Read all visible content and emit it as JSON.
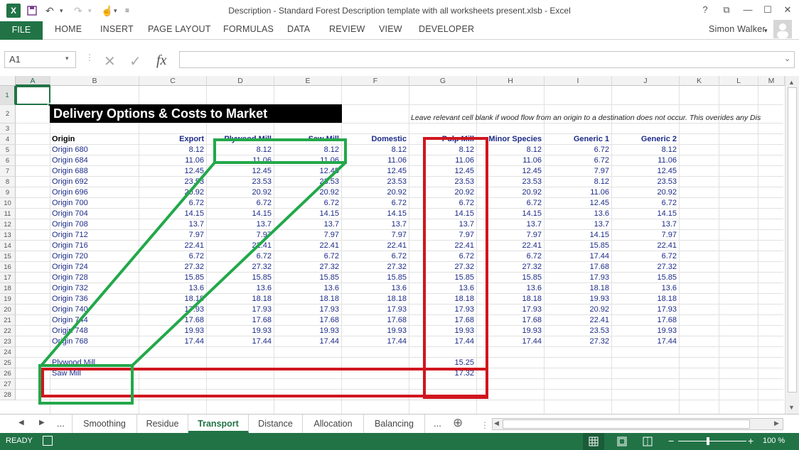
{
  "titlebar": {
    "app_icon": "X",
    "title": "Description - Standard Forest Description template with all worksheets present.xlsb - Excel",
    "help": "?",
    "ribbon_display": "⧉",
    "minimize": "—",
    "maximize": "☐",
    "close": "✕"
  },
  "ribbon": {
    "file": "FILE",
    "tabs": [
      "HOME",
      "INSERT",
      "PAGE LAYOUT",
      "FORMULAS",
      "DATA",
      "REVIEW",
      "VIEW",
      "DEVELOPER"
    ],
    "user": "Simon Walker"
  },
  "formula_bar": {
    "name_box": "A1",
    "cancel": "✕",
    "enter": "✓",
    "fx": "fx",
    "value": ""
  },
  "columns": [
    "A",
    "B",
    "C",
    "D",
    "E",
    "F",
    "G",
    "H",
    "I",
    "J",
    "K",
    "L",
    "M"
  ],
  "rows": [
    "1",
    "2",
    "3",
    "4",
    "5",
    "6",
    "7",
    "8",
    "9",
    "10",
    "11",
    "12",
    "13",
    "14",
    "15",
    "16",
    "17",
    "18",
    "19",
    "20",
    "21",
    "22",
    "23",
    "24",
    "25",
    "26",
    "27",
    "28"
  ],
  "sheet": {
    "banner": "Delivery Options & Costs to Market",
    "note": "Leave relevant cell blank if wood flow from an origin to a destination does not occur.  This overides any Dis",
    "headers": [
      "Origin",
      "Export",
      "Plywood Mill",
      "Saw Mill",
      "Domestic",
      "Pulp Mill",
      "Minor Species",
      "Generic 1",
      "Generic 2"
    ],
    "data": [
      [
        "Origin 680",
        "8.12",
        "8.12",
        "8.12",
        "8.12",
        "8.12",
        "8.12",
        "6.72",
        "8.12"
      ],
      [
        "Origin 684",
        "11.06",
        "11.06",
        "11.06",
        "11.06",
        "11.06",
        "11.06",
        "6.72",
        "11.06"
      ],
      [
        "Origin 688",
        "12.45",
        "12.45",
        "12.45",
        "12.45",
        "12.45",
        "12.45",
        "7.97",
        "12.45"
      ],
      [
        "Origin 692",
        "23.53",
        "23.53",
        "23.53",
        "23.53",
        "23.53",
        "23.53",
        "8.12",
        "23.53"
      ],
      [
        "Origin 696",
        "20.92",
        "20.92",
        "20.92",
        "20.92",
        "20.92",
        "20.92",
        "11.06",
        "20.92"
      ],
      [
        "Origin 700",
        "6.72",
        "6.72",
        "6.72",
        "6.72",
        "6.72",
        "6.72",
        "12.45",
        "6.72"
      ],
      [
        "Origin 704",
        "14.15",
        "14.15",
        "14.15",
        "14.15",
        "14.15",
        "14.15",
        "13.6",
        "14.15"
      ],
      [
        "Origin 708",
        "13.7",
        "13.7",
        "13.7",
        "13.7",
        "13.7",
        "13.7",
        "13.7",
        "13.7"
      ],
      [
        "Origin 712",
        "7.97",
        "7.97",
        "7.97",
        "7.97",
        "7.97",
        "7.97",
        "14.15",
        "7.97"
      ],
      [
        "Origin 716",
        "22.41",
        "22.41",
        "22.41",
        "22.41",
        "22.41",
        "22.41",
        "15.85",
        "22.41"
      ],
      [
        "Origin 720",
        "6.72",
        "6.72",
        "6.72",
        "6.72",
        "6.72",
        "6.72",
        "17.44",
        "6.72"
      ],
      [
        "Origin 724",
        "27.32",
        "27.32",
        "27.32",
        "27.32",
        "27.32",
        "27.32",
        "17.68",
        "27.32"
      ],
      [
        "Origin 728",
        "15.85",
        "15.85",
        "15.85",
        "15.85",
        "15.85",
        "15.85",
        "17.93",
        "15.85"
      ],
      [
        "Origin 732",
        "13.6",
        "13.6",
        "13.6",
        "13.6",
        "13.6",
        "13.6",
        "18.18",
        "13.6"
      ],
      [
        "Origin 736",
        "18.18",
        "18.18",
        "18.18",
        "18.18",
        "18.18",
        "18.18",
        "19.93",
        "18.18"
      ],
      [
        "Origin 740",
        "17.93",
        "17.93",
        "17.93",
        "17.93",
        "17.93",
        "17.93",
        "20.92",
        "17.93"
      ],
      [
        "Origin 744",
        "17.68",
        "17.68",
        "17.68",
        "17.68",
        "17.68",
        "17.68",
        "22.41",
        "17.68"
      ],
      [
        "Origin 748",
        "19.93",
        "19.93",
        "19.93",
        "19.93",
        "19.93",
        "19.93",
        "23.53",
        "19.93"
      ],
      [
        "Origin 768",
        "17.44",
        "17.44",
        "17.44",
        "17.44",
        "17.44",
        "17.44",
        "27.32",
        "17.44"
      ]
    ],
    "extra_rows": [
      {
        "label": "Plywood Mill",
        "pulp": "15.25"
      },
      {
        "label": "Saw Mill",
        "pulp": "17.32"
      }
    ]
  },
  "sheet_tabs": {
    "prev": "◀",
    "next": "▶",
    "more_left": "...",
    "tabs": [
      "Smoothing",
      "Residue",
      "Transport",
      "Distance",
      "Allocation",
      "Balancing"
    ],
    "active": "Transport",
    "more_right": "...",
    "add": "⊕"
  },
  "status": {
    "ready": "READY",
    "zoom_minus": "−",
    "zoom_plus": "+",
    "zoom": "100 %"
  },
  "colors": {
    "excel_green": "#217346",
    "highlight_green": "#22a84a",
    "highlight_red": "#d0161f",
    "cell_text": "#1c2b88"
  }
}
